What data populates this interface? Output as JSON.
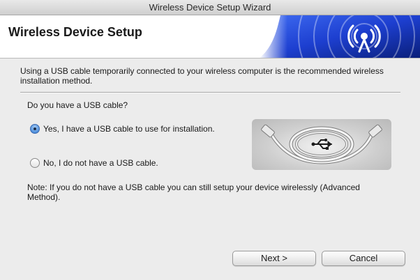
{
  "window": {
    "title": "Wireless Device Setup Wizard"
  },
  "header": {
    "title": "Wireless Device Setup",
    "banner_icon": "wireless-signal-icon",
    "banner_colors": [
      "#0a1f7a",
      "#1d3fd0",
      "#3f6cf2"
    ]
  },
  "intro_text": "Using a USB cable temporarily connected to your wireless computer is the recommended wireless installation method.",
  "question": "Do you have a USB cable?",
  "options": [
    {
      "label": "Yes, I have a USB cable to use for installation.",
      "selected": true
    },
    {
      "label": "No, I do not have a USB cable.",
      "selected": false
    }
  ],
  "usb_image": {
    "icon": "usb-icon"
  },
  "note": "Note: If you do not have a USB cable you can still setup your device wirelessly (Advanced Method).",
  "buttons": {
    "next": "Next >",
    "cancel": "Cancel"
  }
}
